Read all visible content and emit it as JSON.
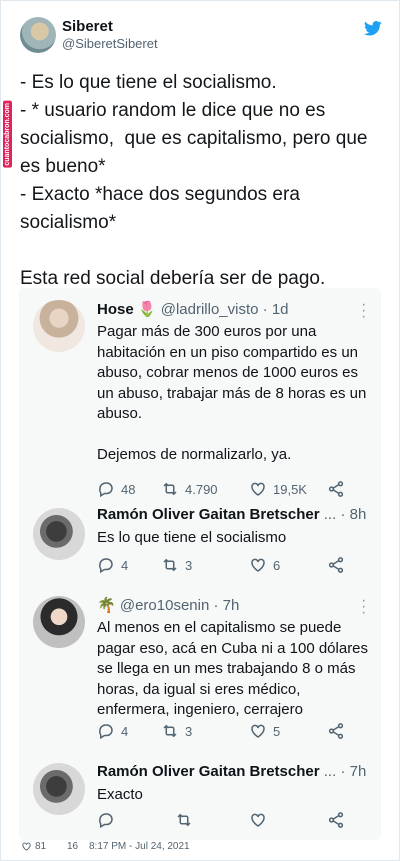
{
  "tweet": {
    "author_name": "Siberet",
    "author_handle": "@SiberetSiberet",
    "lines": [
      "- Es lo que tiene el socialismo.",
      "- * usuario random le dice que no es socialismo,  que es capitalismo, pero que es bueno*",
      "- Exacto *hace dos segundos era socialismo*",
      "",
      "Esta red social debería ser de pago."
    ]
  },
  "watermark": "cuantocabron.com",
  "embedded": [
    {
      "name": "Hose",
      "badge": "🌷",
      "handle": "@ladrillo_visto",
      "time": "· 1d",
      "text": "Pagar más de 300 euros por una habitación en un piso compartido es un abuso, cobrar menos de 1000 euros es un abuso, trabajar más de 8 horas es un abuso.\n\nDejemos de normalizarlo, ya.",
      "replies": "48",
      "retweets": "4.790",
      "likes": "19,5K"
    },
    {
      "name": "Ramón Oliver Gaitan Bretscher",
      "badge": "...",
      "handle": "",
      "time": "· 8h",
      "text": "Es lo que tiene el socialismo",
      "replies": "4",
      "retweets": "3",
      "likes": "6"
    },
    {
      "name": "",
      "badge": "🌴",
      "handle": "@ero10senin",
      "time": "· 7h",
      "text": "Al menos en el capitalismo se puede pagar eso, acá en Cuba ni a 100 dólares se llega en un mes trabajando 8 o más horas, da igual si eres médico, enfermera, ingeniero, cerrajero",
      "replies": "4",
      "retweets": "3",
      "likes": "5"
    },
    {
      "name": "Ramón Oliver Gaitan Bretscher",
      "badge": "...",
      "handle": "",
      "time": "· 7h",
      "text": "Exacto",
      "replies": "",
      "retweets": "",
      "likes": ""
    }
  ],
  "footer": {
    "likes": "81",
    "retweets": "16",
    "timestamp": "8:17 PM - Jul 24, 2021"
  },
  "colors": {
    "bird": "#1da1f2",
    "muted": "#536471",
    "embed_bg": "#f7f9f9"
  }
}
